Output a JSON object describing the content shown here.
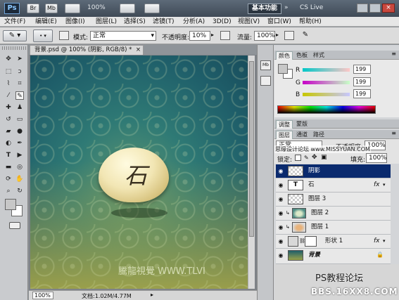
{
  "titlebar": {
    "menu_ps": "Ps",
    "menu_br": "Br",
    "menu_mb": "Mb",
    "zoom": "100%",
    "workspace": "基本功能",
    "cslive": "CS Live"
  },
  "menu": [
    "文件(F)",
    "编辑(E)",
    "图像(I)",
    "图层(L)",
    "选择(S)",
    "滤镜(T)",
    "分析(A)",
    "3D(D)",
    "视图(V)",
    "窗口(W)",
    "帮助(H)"
  ],
  "options": {
    "mode_label": "模式:",
    "mode_value": "正常",
    "opacity_label": "不透明度:",
    "opacity_value": "10%",
    "flow_label": "流量:",
    "flow_value": "100%"
  },
  "document": {
    "tab": "背景.psd @ 100% (阴影, RGB/8) *",
    "close": "×",
    "stone_char": "石",
    "watermark": "騰龍視覺 WWW.TLVI",
    "zoom": "100%",
    "doc_info": "文档:1.02M/4.77M"
  },
  "color_panel": {
    "tabs": [
      "颜色",
      "色板",
      "样式"
    ],
    "r_label": "R",
    "g_label": "G",
    "b_label": "B",
    "r": "199",
    "g": "199",
    "b": "199"
  },
  "adjust_panel": {
    "tabs": [
      "调整",
      "蒙版"
    ]
  },
  "layers_panel": {
    "tabs": [
      "图层",
      "通道",
      "路径"
    ],
    "blend": "正常",
    "opacity_label": "不透明度:",
    "opacity_value": "100%",
    "lock_label": "锁定:",
    "fill_label": "填充:",
    "fill_value": "100%",
    "layers": [
      {
        "name": "阴影",
        "selected": true
      },
      {
        "name": "石",
        "type": "text"
      },
      {
        "name": "图层 3"
      },
      {
        "name": "图层 2"
      },
      {
        "name": "图层 1"
      },
      {
        "name": "形状 1"
      },
      {
        "name": "背景",
        "locked": true
      }
    ]
  },
  "overlay": {
    "site_top": "思缘设计论坛 www.MISSYUAN.COM",
    "forum": "PS教程论坛",
    "forum_url": "BBS.16XX8.COM",
    "fx": "fx"
  }
}
